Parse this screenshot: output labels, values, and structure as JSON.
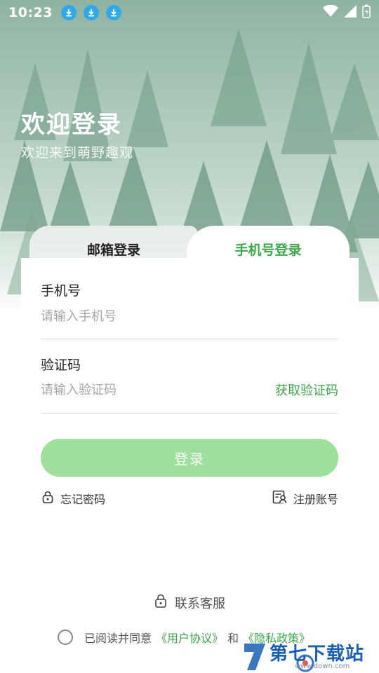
{
  "status_bar": {
    "time": "10:23"
  },
  "header": {
    "title": "欢迎登录",
    "subtitle": "欢迎来到萌野趣观"
  },
  "tabs": [
    {
      "label": "邮箱登录",
      "active": false
    },
    {
      "label": "手机号登录",
      "active": true
    }
  ],
  "form": {
    "phone_label": "手机号",
    "phone_placeholder": "请输入手机号",
    "phone_value": "",
    "code_label": "验证码",
    "code_placeholder": "请输入验证码",
    "code_value": "",
    "get_code_label": "获取验证码",
    "login_label": "登录"
  },
  "links": {
    "forgot_password": "忘记密码",
    "register": "注册账号"
  },
  "footer": {
    "service_label": "联系客服",
    "agree_prefix": "已阅读并同意",
    "user_agreement": "《用户协议》",
    "and": "和",
    "privacy_policy": "《隐私政策》"
  },
  "watermark": {
    "text": "第七下载站",
    "url": "www.down.com"
  },
  "colors": {
    "accent": "#3fa64a",
    "login_button": "#9fe09d",
    "download_badge": "#2fa9e8"
  }
}
